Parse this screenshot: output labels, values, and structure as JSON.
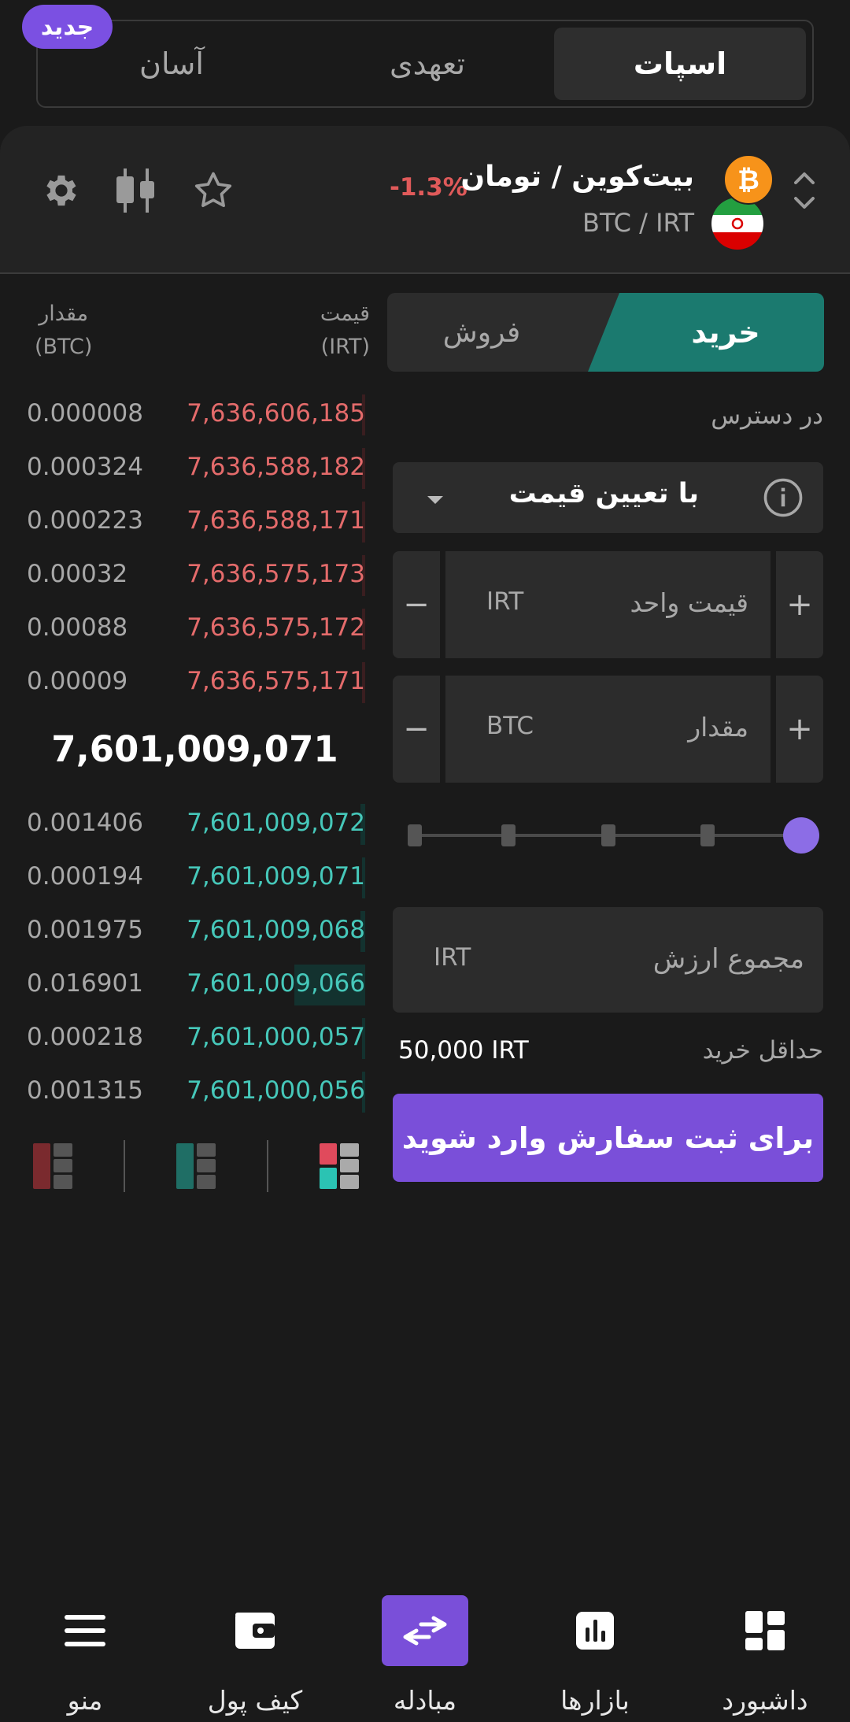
{
  "mode_tabs": [
    {
      "label": "اسپات",
      "active": true
    },
    {
      "label": "تعهدی",
      "active": false
    },
    {
      "label": "آسان",
      "active": false
    }
  ],
  "new_badge": "جدید",
  "market": {
    "title": "بیت‌کوین / تومان",
    "symbol": "BTC / IRT",
    "change": "-1.3%"
  },
  "orderbook": {
    "price_header": "قیمت",
    "price_unit": "(IRT)",
    "amount_header": "مقدار",
    "amount_unit": "(BTC)",
    "asks": [
      {
        "amount": "0.000008",
        "price": "7,636,606,185",
        "depth": 0.0
      },
      {
        "amount": "0.000324",
        "price": "7,636,588,182",
        "depth": 0.01
      },
      {
        "amount": "0.000223",
        "price": "7,636,588,171",
        "depth": 0.01
      },
      {
        "amount": "0.00032",
        "price": "7,636,575,173",
        "depth": 0.01
      },
      {
        "amount": "0.00088",
        "price": "7,636,575,172",
        "depth": 0.02
      },
      {
        "amount": "0.00009",
        "price": "7,636,575,171",
        "depth": 0.0
      }
    ],
    "mid_price": "7,601,009,071",
    "bids": [
      {
        "amount": "0.001406",
        "price": "7,601,009,072",
        "depth": 0.03
      },
      {
        "amount": "0.000194",
        "price": "7,601,009,071",
        "depth": 0.01
      },
      {
        "amount": "0.001975",
        "price": "7,601,009,068",
        "depth": 0.03
      },
      {
        "amount": "0.016901",
        "price": "7,601,009,066",
        "depth": 0.42
      },
      {
        "amount": "0.000218",
        "price": "7,601,000,057",
        "depth": 0.01
      },
      {
        "amount": "0.001315",
        "price": "7,601,000,056",
        "depth": 0.02
      }
    ]
  },
  "trade": {
    "buy_label": "خرید",
    "sell_label": "فروش",
    "available_label": "در دسترس",
    "order_type": "با تعیین قیمت",
    "unit_price_label": "قیمت واحد",
    "unit_price_currency": "IRT",
    "amount_label": "مقدار",
    "amount_currency": "BTC",
    "plus": "+",
    "minus": "−",
    "slider_value": 1.0,
    "total_label": "مجموع ارزش",
    "total_currency": "IRT",
    "min_buy_label": "حداقل خرید",
    "min_buy_value": "50,000 IRT",
    "login_button": "برای ثبت سفارش وارد شوید"
  },
  "bottom_nav": [
    {
      "label": "منو",
      "icon": "menu-icon",
      "active": false
    },
    {
      "label": "کیف پول",
      "icon": "wallet-icon",
      "active": false
    },
    {
      "label": "مبادله",
      "icon": "exchange-icon",
      "active": true
    },
    {
      "label": "بازارها",
      "icon": "markets-icon",
      "active": false
    },
    {
      "label": "داشبورد",
      "icon": "dashboard-icon",
      "active": false
    }
  ],
  "colors": {
    "accent": "#7a4fd9",
    "buy": "#1b7a6f",
    "ask_text": "#e46b6b",
    "bid_text": "#46c8ba",
    "negative": "#e05a5a"
  }
}
